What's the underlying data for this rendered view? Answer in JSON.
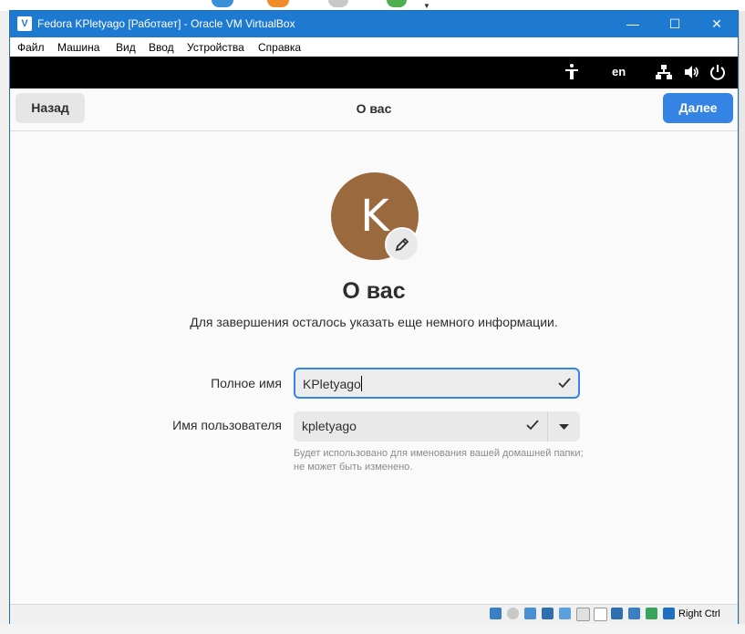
{
  "window": {
    "title": "Fedora KPletyago [Работает] - Oracle VM VirtualBox",
    "controls": {
      "minimize": "—",
      "maximize": "☐",
      "close": "✕"
    }
  },
  "menu": {
    "items": [
      "Файл",
      "Машина",
      "Вид",
      "Ввод",
      "Устройства",
      "Справка"
    ]
  },
  "guest_topbar": {
    "language": "en",
    "icons": [
      "accessibility-icon",
      "network-icon",
      "volume-icon",
      "power-icon"
    ]
  },
  "header": {
    "back_label": "Назад",
    "title": "О вас",
    "next_label": "Далее"
  },
  "profile": {
    "avatar_letter": "K",
    "avatar_color": "#9a6a3e",
    "heading": "О вас",
    "subtitle": "Для завершения осталось указать еще немного информации."
  },
  "form": {
    "fullname_label": "Полное имя",
    "fullname_value": "KPletyago",
    "username_label": "Имя пользователя",
    "username_value": "kpletyago",
    "username_hint": "Будет использовано для именования вашей домашней папки; не может быть изменено."
  },
  "statusbar": {
    "host_key": "Right Ctrl"
  },
  "colors": {
    "accent": "#3584e4",
    "titlebar": "#1e7ad1"
  }
}
